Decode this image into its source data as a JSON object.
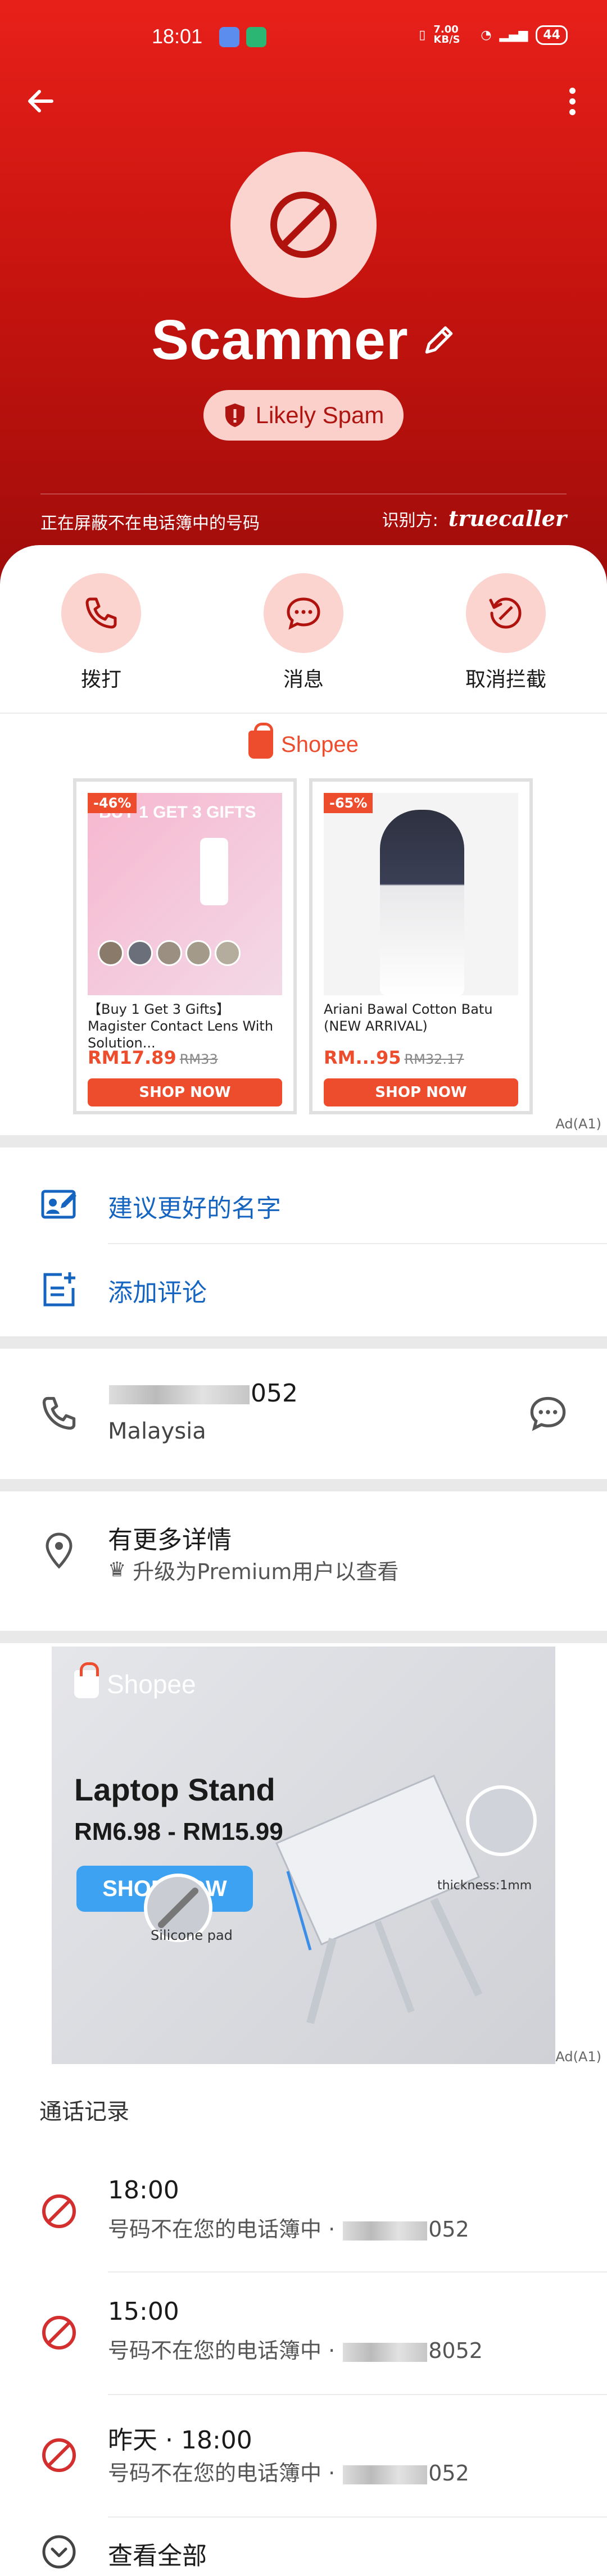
{
  "status_bar": {
    "time": "18:01",
    "speed": "7.00 KB/S",
    "battery": "44"
  },
  "header": {
    "name": "Scammer",
    "badge": "Likely Spam",
    "blocking_text": "正在屏蔽不在电话簿中的号码",
    "identified_by": "识别方:",
    "brand": "truecaller"
  },
  "actions": [
    {
      "label": "拨打",
      "icon": "phone-icon"
    },
    {
      "label": "消息",
      "icon": "message-icon"
    },
    {
      "label": "取消拦截",
      "icon": "unblock-icon"
    }
  ],
  "shopee_ad": {
    "brand": "Shopee",
    "ad_label": "Ad(A1)",
    "products": [
      {
        "discount": "-46%",
        "banner": "BUY 1 GET 3 GIFTS",
        "title": "【Buy 1 Get 3 Gifts】Magister Contact Lens With Solution...",
        "price": "RM17.89",
        "old_price": "RM33",
        "button": "SHOP NOW"
      },
      {
        "discount": "-65%",
        "title": "Ariani Bawal Cotton Batu (NEW ARRIVAL)",
        "price": "RM...95",
        "old_price": "RM32.17",
        "button": "SHOP NOW"
      }
    ]
  },
  "suggest": {
    "label": "建议更好的名字",
    "icon": "edit-name-icon"
  },
  "comment": {
    "label": "添加评论",
    "icon": "add-note-icon"
  },
  "number": {
    "value_suffix": "052",
    "country": "Malaysia"
  },
  "details": {
    "title": "有更多详情",
    "subtitle": "升级为Premium用户以查看"
  },
  "laptop_ad": {
    "brand": "Shopee",
    "headline": "Laptop Stand",
    "price_range": "RM6.98 - RM15.99",
    "button": "SHOP NOW",
    "note1": "thickness:1mm",
    "note2": "Silicone pad",
    "ad_label": "Ad(A1)"
  },
  "call_log": {
    "title": "通话记录",
    "items": [
      {
        "time": "18:00",
        "desc": "号码不在您的电话簿中 · ",
        "suffix": "052"
      },
      {
        "time": "15:00",
        "desc": "号码不在您的电话簿中 · ",
        "suffix": "8052"
      },
      {
        "time": "昨天 · 18:00",
        "desc": "号码不在您的电话簿中 · ",
        "suffix": "052"
      }
    ],
    "view_all": "查看全部"
  },
  "colors": {
    "hero": "#d4170f",
    "accent_pink": "#fbd3cf",
    "shopee": "#ee4d2d",
    "link_blue": "#1565c0"
  }
}
